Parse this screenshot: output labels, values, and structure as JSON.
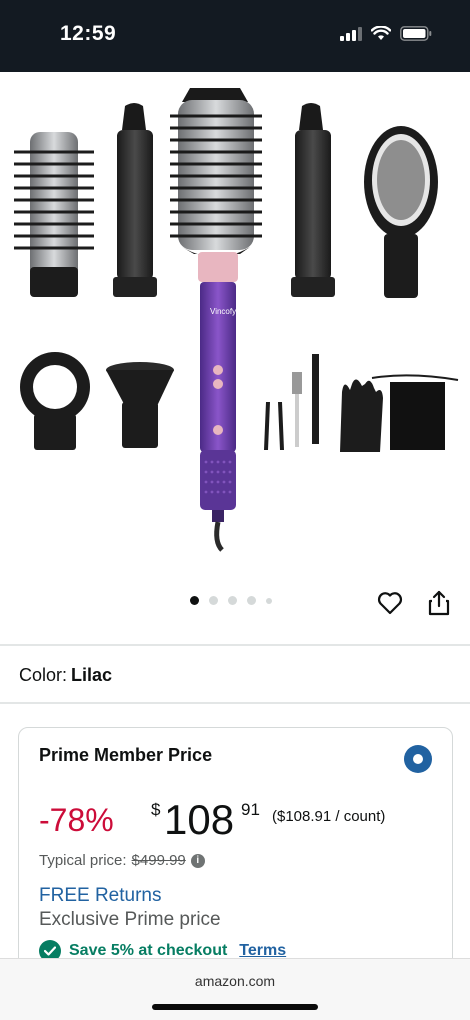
{
  "status_bar": {
    "time": "12:59"
  },
  "gallery": {
    "brand_on_device": "Vincofy",
    "image_count": 5,
    "active_index": 0
  },
  "actions": {
    "wishlist_icon": "heart-icon",
    "share_icon": "share-icon"
  },
  "color": {
    "label": "Color:",
    "value": "Lilac"
  },
  "price_card": {
    "title": "Prime Member Price",
    "discount": "-78%",
    "currency_symbol": "$",
    "price_whole": "108",
    "price_fraction": "91",
    "price_per_unit": "($108.91 / count)",
    "typical_label": "Typical price:",
    "typical_price": "$499.99",
    "returns": "FREE Returns",
    "exclusive": "Exclusive Prime price",
    "save_text": "Save 5% at checkout",
    "terms": "Terms"
  },
  "browser": {
    "url": "amazon.com"
  },
  "colors": {
    "accent_blue": "#2162a1",
    "deal_red": "#cc0c39",
    "success_green": "#067d62",
    "device_purple": "#6b3fa0"
  }
}
